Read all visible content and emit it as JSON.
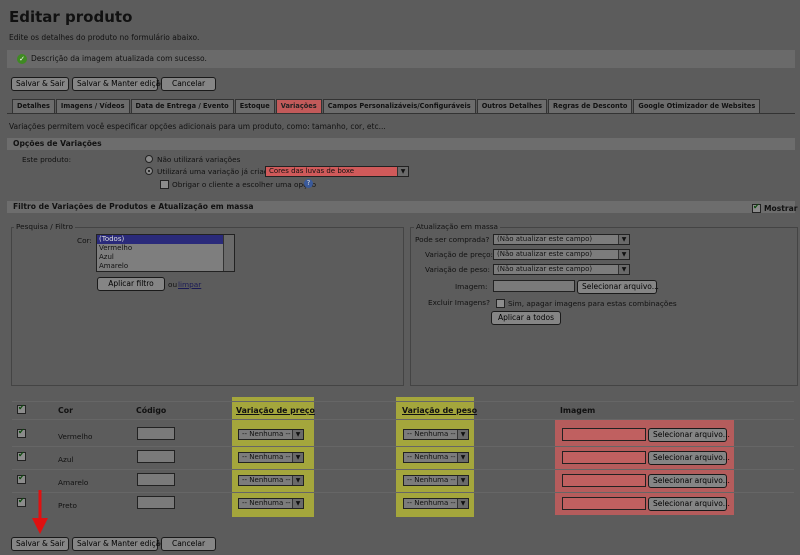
{
  "page": {
    "title": "Editar produto",
    "subtitle": "Edite os detalhes do produto no formulário abaixo.",
    "notice": "Descrição da imagem atualizada com sucesso."
  },
  "actions": {
    "save_exit": "Salvar & Sair",
    "save_keep": "Salvar & Manter edição",
    "cancel": "Cancelar"
  },
  "tabs": [
    "Detalhes",
    "Imagens / Vídeos",
    "Data de Entrega / Evento",
    "Estoque",
    "Variações",
    "Campos Personalizáveis/Configuráveis",
    "Outros Detalhes",
    "Regras de Desconto",
    "Google Otimizador de Websites"
  ],
  "active_tab": "Variações",
  "description": "Variações permitem você especificar opções adicionais para um produto, como: tamanho, cor, etc...",
  "options": {
    "heading": "Opções de Variações",
    "product_label": "Este produto:",
    "radio_none": "Não utilizará variações",
    "radio_existing": "Utilizará uma variação já criada:",
    "variation_selected": "Cores das luvas de boxe",
    "force_choice": "Obrigar o cliente a escolher uma opção",
    "help_icon": "?"
  },
  "filter": {
    "heading": "Filtro de Variações de Produtos e Atualização em massa",
    "show_label": "Mostrar",
    "search_legend": "Pesquisa / Filtro",
    "color_label": "Cor:",
    "color_options": [
      "(Todos)",
      "Vermelho",
      "Azul",
      "Amarelo"
    ],
    "apply_filter": "Aplicar filtro",
    "or_text": "ou",
    "clear_link": "limpar"
  },
  "bulk": {
    "legend": "Atualização em massa",
    "can_buy_label": "Pode ser comprada?",
    "price_var_label": "Variação de preço:",
    "weight_var_label": "Variação de peso:",
    "no_update": "(Não atualizar este campo)",
    "image_label": "Imagem:",
    "select_file": "Selecionar arquivo...",
    "delete_images_label": "Excluir Imagens?",
    "delete_images_option": "Sim, apagar imagens para estas combinações",
    "apply_all": "Aplicar a todos"
  },
  "table": {
    "headers": {
      "color": "Cor",
      "code": "Código",
      "price_var": "Variação de preço",
      "weight_var": "Variação de peso",
      "image": "Imagem"
    },
    "none_option": "-- Nenhuma --",
    "select_file": "Selecionar arquivo...",
    "rows": [
      {
        "color": "Vermelho"
      },
      {
        "color": "Azul"
      },
      {
        "color": "Amarelo"
      },
      {
        "color": "Preto"
      }
    ]
  },
  "colors": {
    "highlight_yellow": "#a4a63c",
    "highlight_red": "#b55c5c",
    "arrow_red": "#e01010"
  }
}
